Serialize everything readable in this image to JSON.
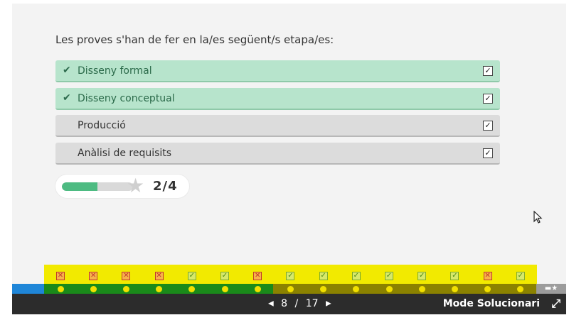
{
  "question": "Les proves s'han de fer en la/es següent/s etapa/es:",
  "options": [
    {
      "label": "Disseny formal",
      "state": "correct",
      "checked": true
    },
    {
      "label": "Disseny conceptual",
      "state": "correct",
      "checked": true
    },
    {
      "label": "Producció",
      "state": "neutral",
      "checked": true
    },
    {
      "label": "Anàlisi de requisits",
      "state": "neutral",
      "checked": true
    }
  ],
  "score": {
    "text": "2/4",
    "fraction": 0.5
  },
  "markers": [
    "wrong",
    "wrong",
    "wrong",
    "wrong",
    "right",
    "right",
    "wrong",
    "right",
    "right",
    "right",
    "right",
    "right",
    "right",
    "wrong",
    "right"
  ],
  "navigation": {
    "current": "8",
    "separator": "/",
    "total": "17",
    "prev_icon": "triangle-left-icon",
    "next_icon": "triangle-right-icon"
  },
  "mode_label": "Mode Solucionari",
  "expand_icon": "expand-icon",
  "colors": {
    "correct_bg": "#b7e4cc",
    "neutral_bg": "#dcdcdc",
    "progress_done": "#1a8a1a",
    "marker_strip": "#f2ea00"
  }
}
